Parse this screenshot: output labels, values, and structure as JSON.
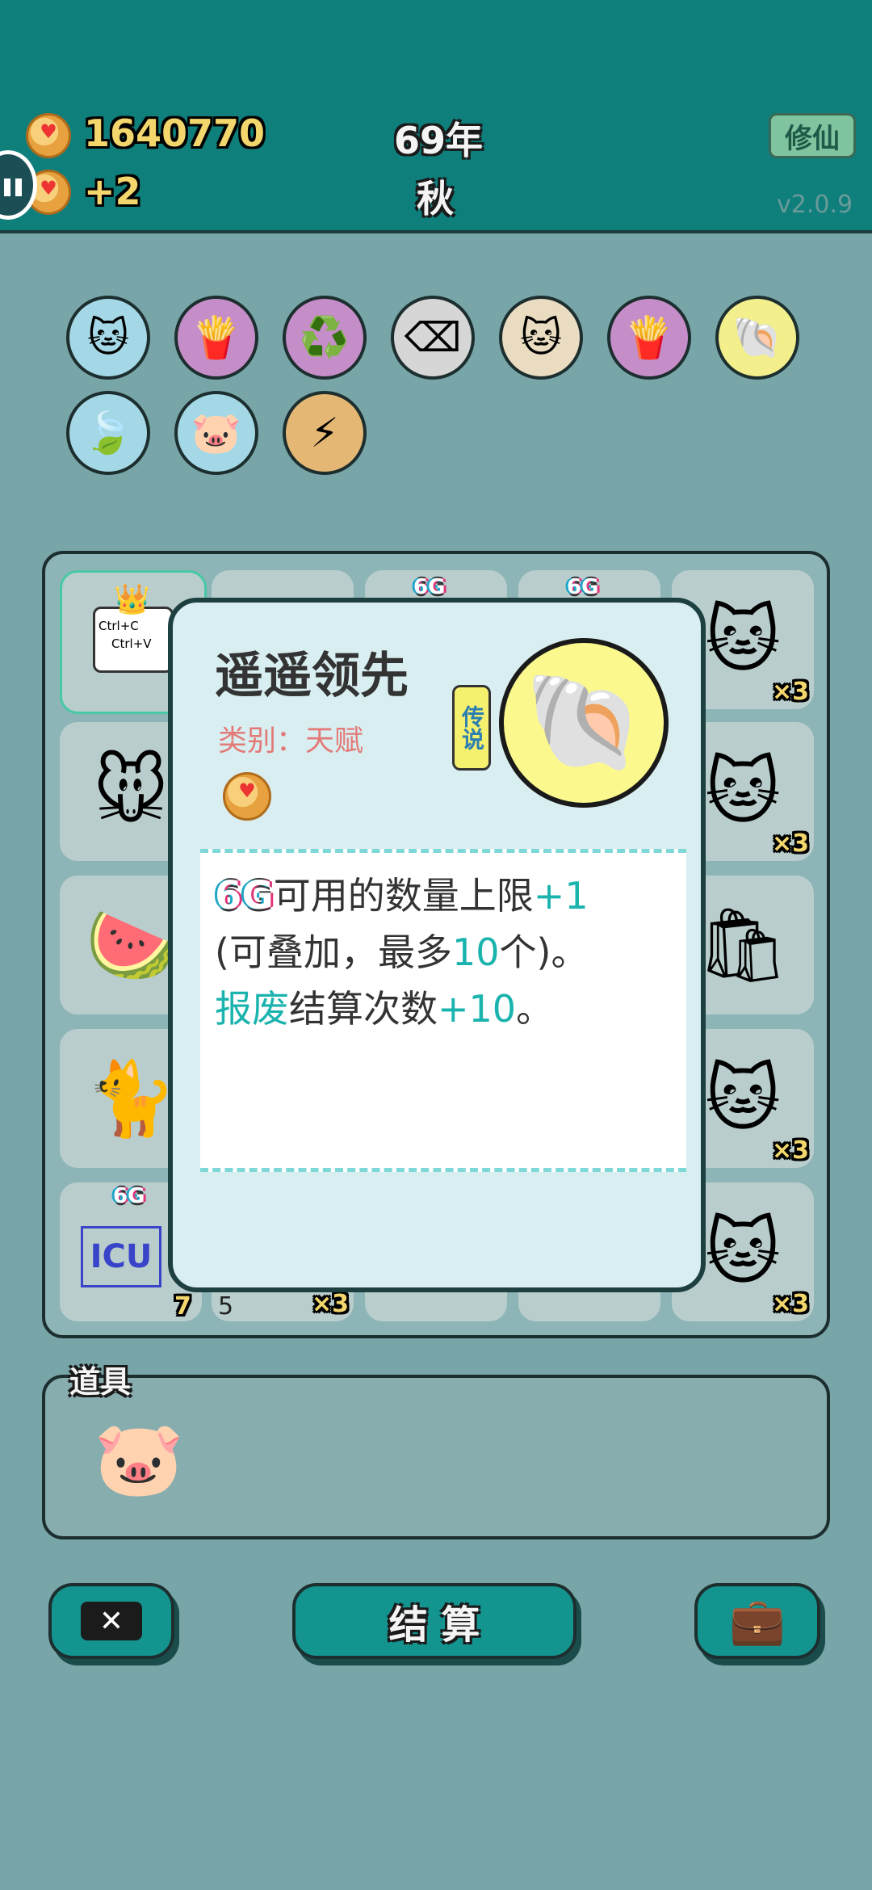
{
  "header": {
    "coins": "1640770",
    "income": "+2",
    "year": "69年",
    "season": "秋",
    "cultivate_button": "修仙",
    "version": "v2.0.9"
  },
  "skills": [
    {
      "icon": "cat-icon",
      "glyph": "🐱",
      "bg": "#a5d8e6"
    },
    {
      "icon": "fries-icon",
      "glyph": "🍟",
      "bg": "#c68ec8"
    },
    {
      "icon": "recycle-icon",
      "glyph": "♻️",
      "bg": "#c68ec8"
    },
    {
      "icon": "delete-tag-icon",
      "glyph": "⌫",
      "bg": "#d6d6d6"
    },
    {
      "icon": "twin-cats-icon",
      "glyph": "🐱",
      "bg": "#e9dcc1"
    },
    {
      "icon": "fries-icon",
      "glyph": "🍟",
      "bg": "#c68ec8"
    },
    {
      "icon": "shell-icon",
      "glyph": "🐚",
      "bg": "#f2ef8c"
    },
    {
      "icon": "leaf-icon",
      "glyph": "🍃",
      "bg": "#a5d8e6"
    },
    {
      "icon": "piggy-bank-icon",
      "glyph": "🐷",
      "bg": "#a5d8e6"
    },
    {
      "icon": "lightning-icon",
      "glyph": "⚡",
      "bg": "#e4b874"
    }
  ],
  "grid_labels": {
    "sixg_a": "6G",
    "sixg_b": "6G",
    "sixg_c": "6G",
    "ctrl_c": "Ctrl+C",
    "ctrl_v": "Ctrl+V",
    "x3": "×3",
    "num7": "7",
    "num5": "5",
    "icu": "ICU"
  },
  "tools": {
    "label": "道具"
  },
  "footer": {
    "settle_button": "结 算"
  },
  "modal": {
    "title": "遥遥领先",
    "category": "类别：天赋",
    "rarity": "传说",
    "desc_line1_pre": "6G",
    "desc_line1_mid": "可用的数量上限",
    "desc_line1_plus": "+1",
    "desc_line2_a": "(可叠加，最多",
    "desc_line2_num": "10",
    "desc_line2_b": "个)。",
    "desc_line3_kw": "报废",
    "desc_line3_mid": "结算次数",
    "desc_line3_num": "+10",
    "desc_line3_end": "。"
  }
}
